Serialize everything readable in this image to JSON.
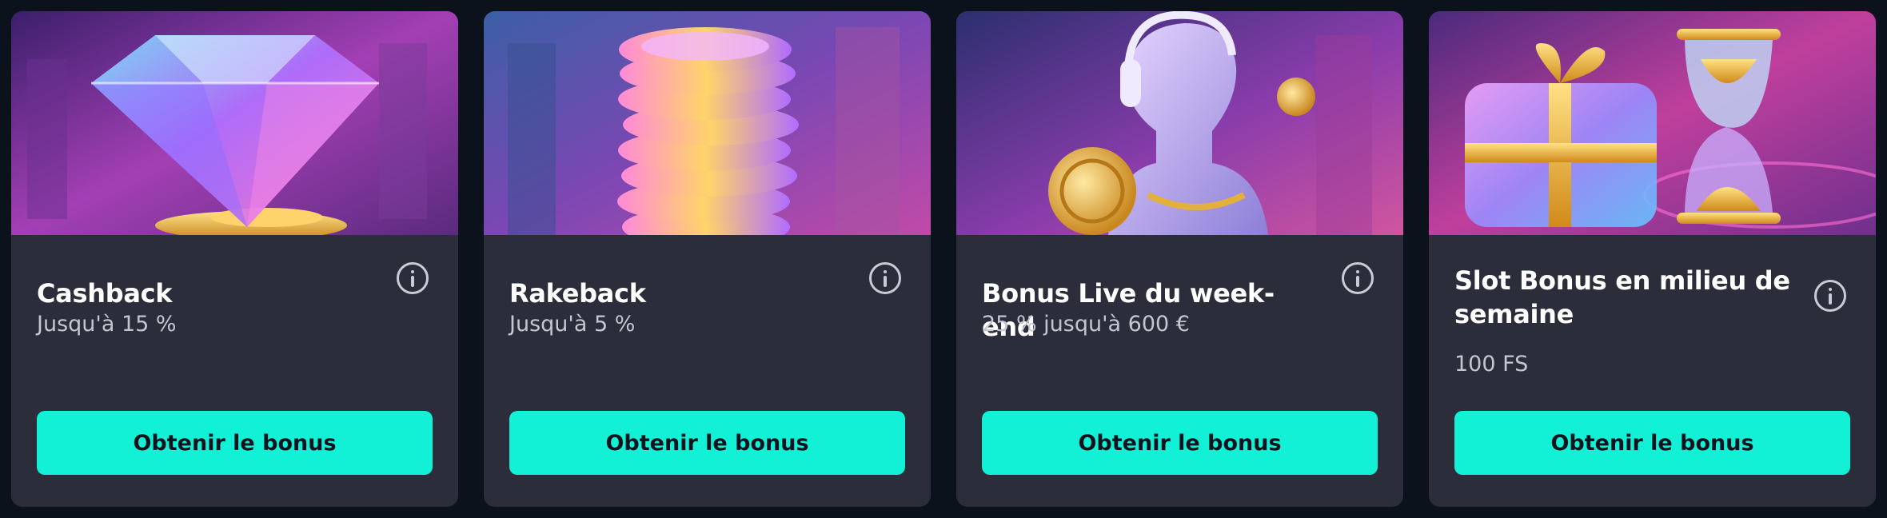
{
  "colors": {
    "page_background": "#0c121b",
    "card_background": "#2c2d3a",
    "accent": "#12f0d6",
    "button_text": "#10131d",
    "title_text": "#ffffff",
    "subtitle_text": "#c4c6d0"
  },
  "cards": [
    {
      "title": "Cashback",
      "subtitle": "Jusqu'à 15 %",
      "button_label": "Obtenir le bonus",
      "info_icon": "info-icon",
      "artwork": "diamond"
    },
    {
      "title": "Rakeback",
      "subtitle": "Jusqu'à 5 %",
      "button_label": "Obtenir le bonus",
      "info_icon": "info-icon",
      "artwork": "coin-stack"
    },
    {
      "title": "Bonus Live du week-end",
      "subtitle": "25 % jusqu'à 600 €",
      "button_label": "Obtenir le bonus",
      "info_icon": "info-icon",
      "artwork": "statue-with-headphones"
    },
    {
      "title": "Slot Bonus en milieu de semaine",
      "subtitle": "100 FS",
      "button_label": "Obtenir le bonus",
      "info_icon": "info-icon",
      "artwork": "gift-and-hourglass"
    }
  ]
}
